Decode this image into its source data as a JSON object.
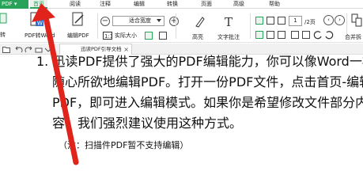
{
  "menubar": {
    "app_button": "PDF ▾",
    "items": [
      {
        "label": "首页",
        "active": true
      },
      {
        "label": "阅读"
      },
      {
        "label": "注释"
      },
      {
        "label": "编辑"
      },
      {
        "label": "转换"
      },
      {
        "label": "页面"
      },
      {
        "label": "高级"
      },
      {
        "label": "帮助"
      }
    ],
    "accent_color": "#2aa35a"
  },
  "toolbar": {
    "left_partial_label": "转",
    "pdf_convert_label": "PDF转Word",
    "edit_pdf_label": "编辑PDF",
    "actual_size_label": "实际大小",
    "zoom_value": "适合宽度",
    "highlight_label": "高亮",
    "text_note_label": "文字批注",
    "page_current": "1",
    "page_total": "/2页",
    "merge_label": "合并拆"
  },
  "tab": {
    "title": "迅读PDF引导文档",
    "close_icon": "close-icon"
  },
  "document": {
    "lines": [
      "1. 迅读PDF提供了强大的PDF编辑能力，你可以像Word一样",
      "随心所欲地编辑PDF。打开一份PDF文件，点击首页-编辑",
      "PDF，即可进入编辑模式。如果你是希望修改文件部分内",
      "容，我们强烈建议使用这种方式。"
    ],
    "note": "（注：扫描件PDF暂不支持编辑）"
  },
  "annotation": {
    "arrow_color": "#e0241c"
  }
}
